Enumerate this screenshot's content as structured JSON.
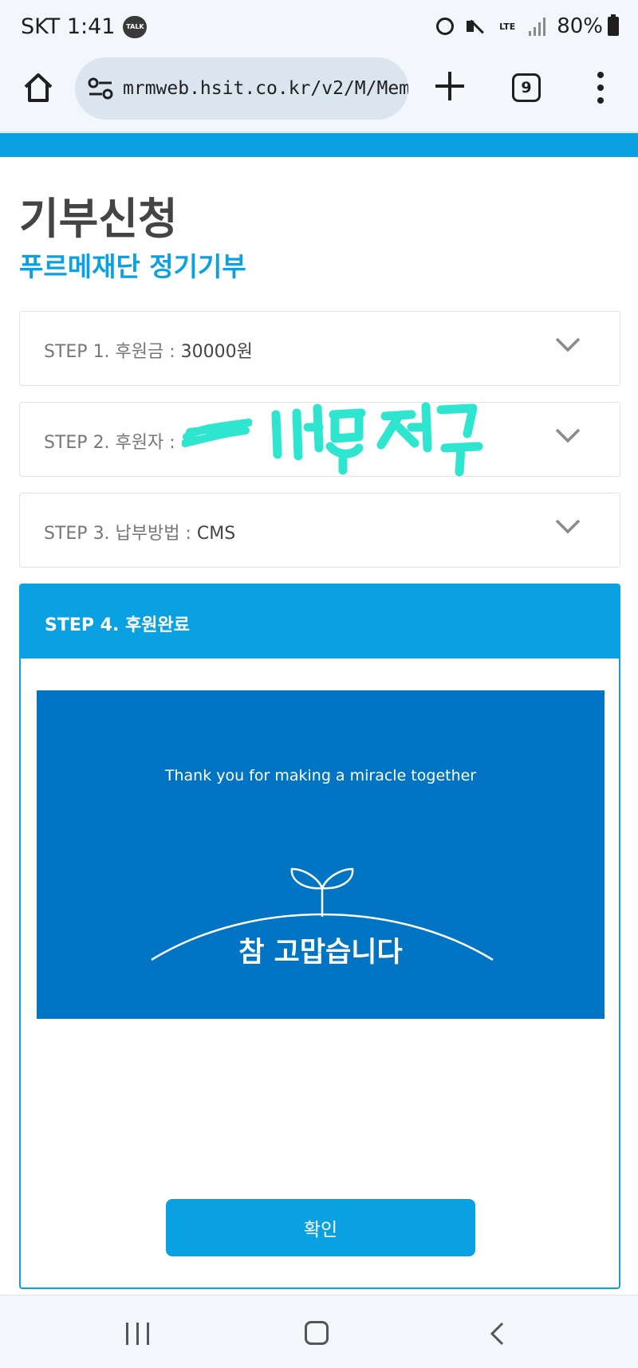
{
  "status_bar": {
    "carrier_time": "SKT 1:41",
    "talk_badge": "TALK",
    "network": "LTE",
    "battery": "80%"
  },
  "browser": {
    "url": "mrmweb.hsit.co.kr/v2/M/Memb",
    "tab_count": "9"
  },
  "page": {
    "title": "기부신청",
    "subtitle": "푸르메재단 정기기부"
  },
  "steps": [
    {
      "label": "STEP 1. 후원금 : ",
      "value": "30000원"
    },
    {
      "label": "STEP 2. 후원자 : ",
      "value": ""
    },
    {
      "label": "STEP 3. 납부방법 : ",
      "value": "CMS"
    }
  ],
  "step4": {
    "label": "STEP 4. 후원완료",
    "banner_en": "Thank you for making a miracle together",
    "banner_kr": "참 고맙습니다",
    "confirm_label": "확인"
  },
  "colors": {
    "accent": "#0aa1e2",
    "banner": "#0175c3",
    "redaction": "#2ee6cf"
  },
  "icons": [
    "home-icon",
    "tune-icon",
    "plus-icon",
    "tabs-icon",
    "more-vert-icon",
    "chevron-down-icon",
    "sprout-icon",
    "recents-icon",
    "nav-home-icon",
    "back-icon"
  ]
}
